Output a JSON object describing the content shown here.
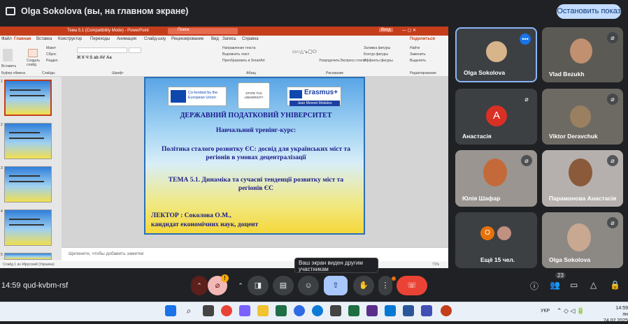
{
  "topbar": {
    "presenter": "Olga Sokolova (вы, на главном экране)",
    "stop_label": "Остановить показ"
  },
  "ppt": {
    "title": "Тема 5.1 (Compatibility Mode) - PowerPoint",
    "search": "Поиск",
    "signin": "Вход",
    "tabs": [
      "Файл",
      "Главная",
      "Вставка",
      "Конструктор",
      "Переходы",
      "Анимация",
      "Слайд-шоу",
      "Рецензирование",
      "Вид",
      "Запись",
      "Справка"
    ],
    "share": "Поделиться",
    "ribbon_groups": [
      "Буфер обмена",
      "Слайды",
      "Шрифт",
      "Абзац",
      "Рисование",
      "Редактирование"
    ],
    "ribbon_items": [
      "Вставить",
      "Создать слайд",
      "Макет",
      "Сброс",
      "Раздел",
      "Направление текста",
      "Выровнять текст",
      "Преобразовать в SmartArt",
      "Упорядочить",
      "Экспресс-стили",
      "Заливка фигуры",
      "Контур фигуры",
      "Эффекты фигуры",
      "Найти",
      "Заменить",
      "Выделить"
    ],
    "notes_placeholder": "Щелкните, чтобы добавить заметки",
    "status_left": "Слайд 1 из 46",
    "status_lang": "русский (Украина)",
    "zoom": "71%",
    "thumb_numbers": [
      "1",
      "2",
      "3",
      "4",
      "5"
    ]
  },
  "slide": {
    "logo_eu": "Co-funded by the European Union",
    "logo_stu": "STATE TAX UNIVERSITY",
    "logo_erasmus": "Erasmus+",
    "logo_jm": "Jean Monnet Modules",
    "university": "ДЕРЖАВНИЙ ПОДАТКОВИЙ УНІВЕРСИТЕТ",
    "course_type": "Навчальний тренінг-курс:",
    "course_title": "Політика сталого розвитку ЄС: досвід для українських міст та регіонів в умовах децентралізації",
    "topic": "ТЕМА 5.1. Динаміка та сучасні тенденції розвитку міст та регіонів ЄС",
    "lecturer": "ЛЕКТОР : Соколова О.М.,",
    "degree": "кандидат економічних наук, доцент"
  },
  "participants": [
    {
      "name": "Olga Sokolova"
    },
    {
      "name": "Vlad Bezukh"
    },
    {
      "name": "Анастасія",
      "initial": "А"
    },
    {
      "name": "Viktor Deravchuk"
    },
    {
      "name": "Юлія Шафар"
    },
    {
      "name": "Парамонова Анастасія"
    },
    {
      "name": "Ещё 15 чел.",
      "initial": "О"
    },
    {
      "name": "Olga Sokolova"
    }
  ],
  "controls": {
    "time": "14:59",
    "meeting_code": "qud-kvbm-rsf",
    "tooltip": "Ваш экран виден другим участникам",
    "people_count": "23"
  },
  "taskbar": {
    "lang": "УКР",
    "clock": "14:59",
    "date": "пн 24.02.2025"
  },
  "colors": {
    "accent": "#8ab4f8",
    "stop_bg": "#c2dbff",
    "hangup": "#ea4335",
    "present": "#a8c7fa",
    "ppt_title": "#c43e1c",
    "avatar_a": "#d93025",
    "avatar_o": "#e8710a"
  }
}
